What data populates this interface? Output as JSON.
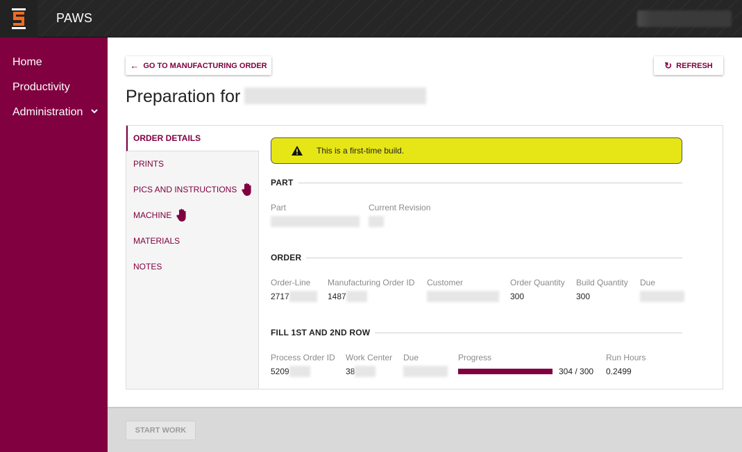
{
  "app": {
    "title": "PAWS",
    "logo_icon": "paws-s-logo",
    "user_name_redacted": true
  },
  "sidebar": {
    "items": [
      {
        "label": "Home"
      },
      {
        "label": "Productivity"
      },
      {
        "label": "Administration",
        "icon": "chevron-down-icon",
        "glyph": "⌵"
      }
    ]
  },
  "toolbar": {
    "back_label": "GO TO MANUFACTURING ORDER",
    "back_icon": "←",
    "refresh_label": "REFRESH",
    "refresh_icon": "↻"
  },
  "page": {
    "title_prefix": "Preparation for"
  },
  "tabs": [
    {
      "label": "ORDER DETAILS",
      "active": true,
      "hand": false
    },
    {
      "label": "PRINTS",
      "active": false,
      "hand": false
    },
    {
      "label": "PICS AND INSTRUCTIONS",
      "active": false,
      "hand": true
    },
    {
      "label": "MACHINE",
      "active": false,
      "hand": true
    },
    {
      "label": "MATERIALS",
      "active": false,
      "hand": false
    },
    {
      "label": "NOTES",
      "active": false,
      "hand": false
    }
  ],
  "alert": {
    "text": "This is a first-time build.",
    "icon": "warning-icon",
    "color": "#e6e617"
  },
  "sections": {
    "part": {
      "title": "PART",
      "fields": [
        {
          "label": "Part",
          "value": ""
        },
        {
          "label": "Current Revision",
          "value": ""
        }
      ]
    },
    "order": {
      "title": "ORDER",
      "fields": [
        {
          "label": "Order-Line",
          "value": "2717"
        },
        {
          "label": "Manufacturing Order ID",
          "value": "1487"
        },
        {
          "label": "Customer",
          "value": ""
        },
        {
          "label": "Order Quantity",
          "value": "300"
        },
        {
          "label": "Build Quantity",
          "value": "300"
        },
        {
          "label": "Due",
          "value": ""
        }
      ]
    },
    "process": {
      "title": "FILL 1ST AND 2ND ROW",
      "fields": [
        {
          "label": "Process Order ID",
          "value": "5209"
        },
        {
          "label": "Work Center",
          "value": "38"
        },
        {
          "label": "Due",
          "value": ""
        },
        {
          "label": "Progress",
          "value": "304 / 300",
          "completed": 304,
          "target": 300,
          "fraction": 1.0
        },
        {
          "label": "Run Hours",
          "value": "0.2499"
        }
      ]
    }
  },
  "footer": {
    "start_label": "START WORK",
    "start_disabled": true
  },
  "colors": {
    "brand": "#800040",
    "topbar": "#262626",
    "alert": "#e6e617",
    "logo_orange": "#f26b1d"
  }
}
